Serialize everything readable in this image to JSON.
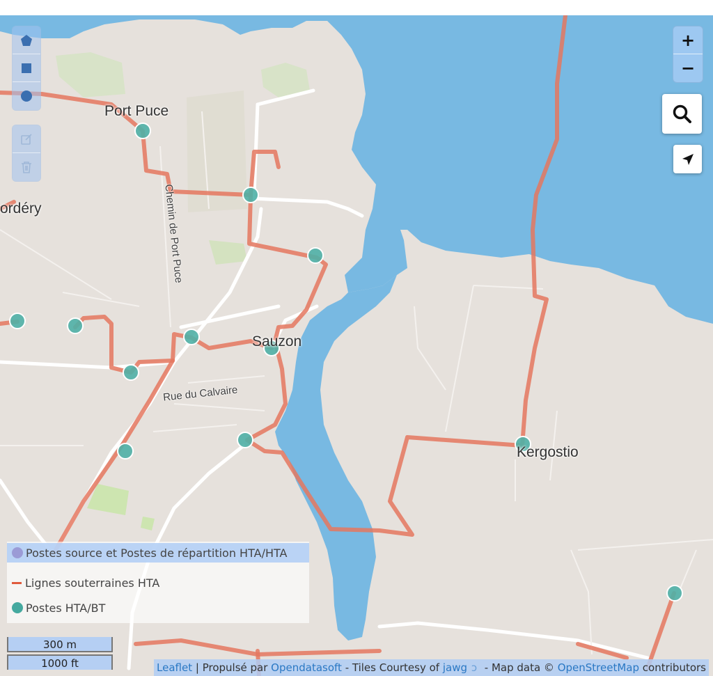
{
  "map": {
    "place_labels": [
      {
        "text": "Port Puce"
      },
      {
        "text": "ordéry"
      },
      {
        "text": "Sauzon"
      },
      {
        "text": "Kergostio"
      }
    ],
    "road_labels": [
      {
        "text": "Chemin de Port Puce"
      },
      {
        "text": "Rue du Calvaire"
      }
    ]
  },
  "draw_toolbar": {
    "tools": [
      {
        "icon": "polygon-icon"
      },
      {
        "icon": "rectangle-icon"
      },
      {
        "icon": "circle-icon"
      }
    ],
    "edit_tools": [
      {
        "icon": "edit-icon"
      },
      {
        "icon": "trash-icon"
      }
    ]
  },
  "zoom": {
    "in_label": "+",
    "out_label": "−"
  },
  "search": {
    "icon": "search-icon"
  },
  "locate": {
    "icon": "locate-arrow-icon"
  },
  "legend": {
    "items": [
      {
        "label": "Postes source et Postes de répartition HTA/HTA",
        "color": "#9b9bd6",
        "shape": "dot"
      },
      {
        "label": "Lignes souterraines HTA",
        "color": "#e05a3c",
        "shape": "dash"
      },
      {
        "label": "Postes HTA/BT",
        "color": "#45a99f",
        "shape": "dot"
      }
    ]
  },
  "scale": {
    "metric": "300 m",
    "imperial": "1000 ft"
  },
  "attribution": {
    "leaflet": "Leaflet",
    "sep": " | Propulsé par ",
    "ods": "Opendatasoft",
    "tiles": " - Tiles Courtesy of ",
    "jawg": "jawg",
    "mapdata": " - Map data © ",
    "osm": "OpenStreetMap",
    "contrib": " contributors"
  },
  "colors": {
    "water": "#78b9e2",
    "land": "#e6e1dc",
    "line": "#e4775f",
    "station": "#4fb0a6"
  }
}
